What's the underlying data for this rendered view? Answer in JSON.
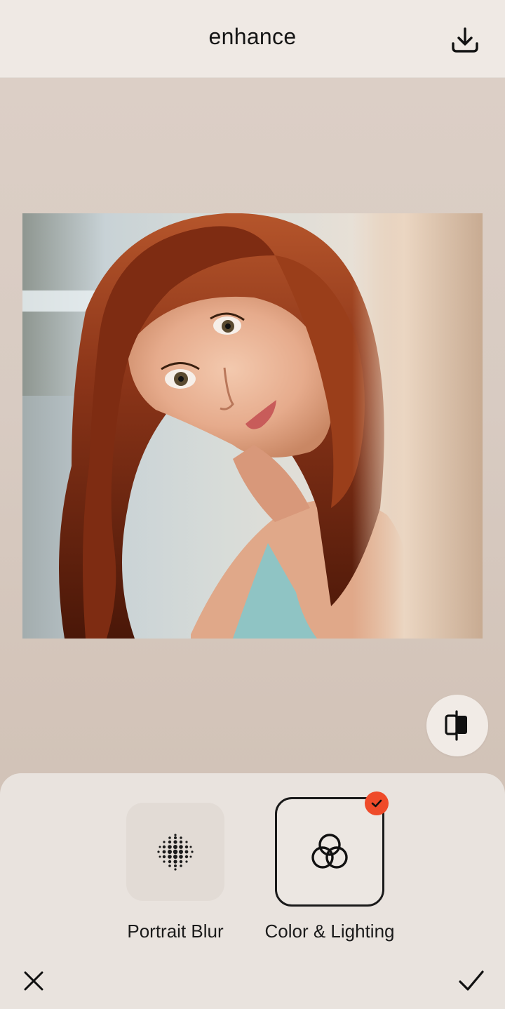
{
  "header": {
    "title": "enhance",
    "download_icon": "download-icon"
  },
  "photo": {
    "description_icon": "sparkle-icon"
  },
  "compare": {
    "icon": "compare-split-icon"
  },
  "tools": [
    {
      "label": "Portrait Blur",
      "icon": "dots-grid-icon",
      "selected": false
    },
    {
      "label": "Color & Lighting",
      "icon": "intertwined-circles-icon",
      "selected": true
    }
  ],
  "footer": {
    "close_icon": "close-icon",
    "confirm_icon": "checkmark-icon"
  },
  "colors": {
    "accent_badge": "#ef4b2a",
    "selected_border": "#1a1a1a",
    "sheet_bg": "#e9e3de",
    "topbar_bg": "#efe9e4"
  }
}
